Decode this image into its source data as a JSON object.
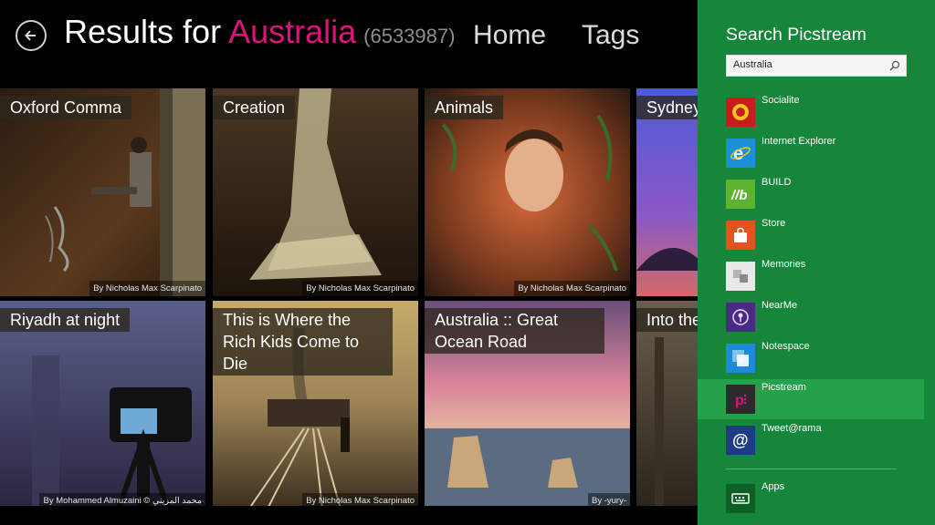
{
  "header": {
    "title_prefix": "Results for ",
    "query": "Australia",
    "count": "(6533987)",
    "nav": [
      "Home",
      "Tags"
    ]
  },
  "tiles": [
    {
      "caption": "Oxford Comma",
      "credit": "By Nicholas Max Scarpinato"
    },
    {
      "caption": "Creation",
      "credit": "By Nicholas Max Scarpinato"
    },
    {
      "caption": "Animals",
      "credit": "By Nicholas Max Scarpinato"
    },
    {
      "caption": "Sydney",
      "credit": ""
    },
    {
      "caption": "Riyadh at night",
      "credit": "By Mohammed Almuzaini © محمد المزيني"
    },
    {
      "caption": "This is Where the Rich Kids Come to Die",
      "credit": "By Nicholas Max Scarpinato"
    },
    {
      "caption": "Australia :: Great Ocean Road",
      "credit": "By -yury-"
    },
    {
      "caption": "Into the",
      "credit": ""
    }
  ],
  "search_pane": {
    "title": "Search Picstream",
    "query": "Australia",
    "apps": [
      {
        "label": "Socialite",
        "color": "#c81c1c"
      },
      {
        "label": "Internet Explorer",
        "color": "#1b8fd8"
      },
      {
        "label": "BUILD",
        "color": "#5fb22f"
      },
      {
        "label": "Store",
        "color": "#e2531d"
      },
      {
        "label": "Memories",
        "color": "#e9e9e9"
      },
      {
        "label": "NearMe",
        "color": "#4a2b84"
      },
      {
        "label": "Notespace",
        "color": "#1f8ad6"
      },
      {
        "label": "Picstream",
        "color": "#2b2b2b"
      },
      {
        "label": "Tweet@rama",
        "color": "#1c3d86"
      }
    ],
    "apps_footer": {
      "label": "Apps",
      "color": "#0e5f26"
    }
  }
}
